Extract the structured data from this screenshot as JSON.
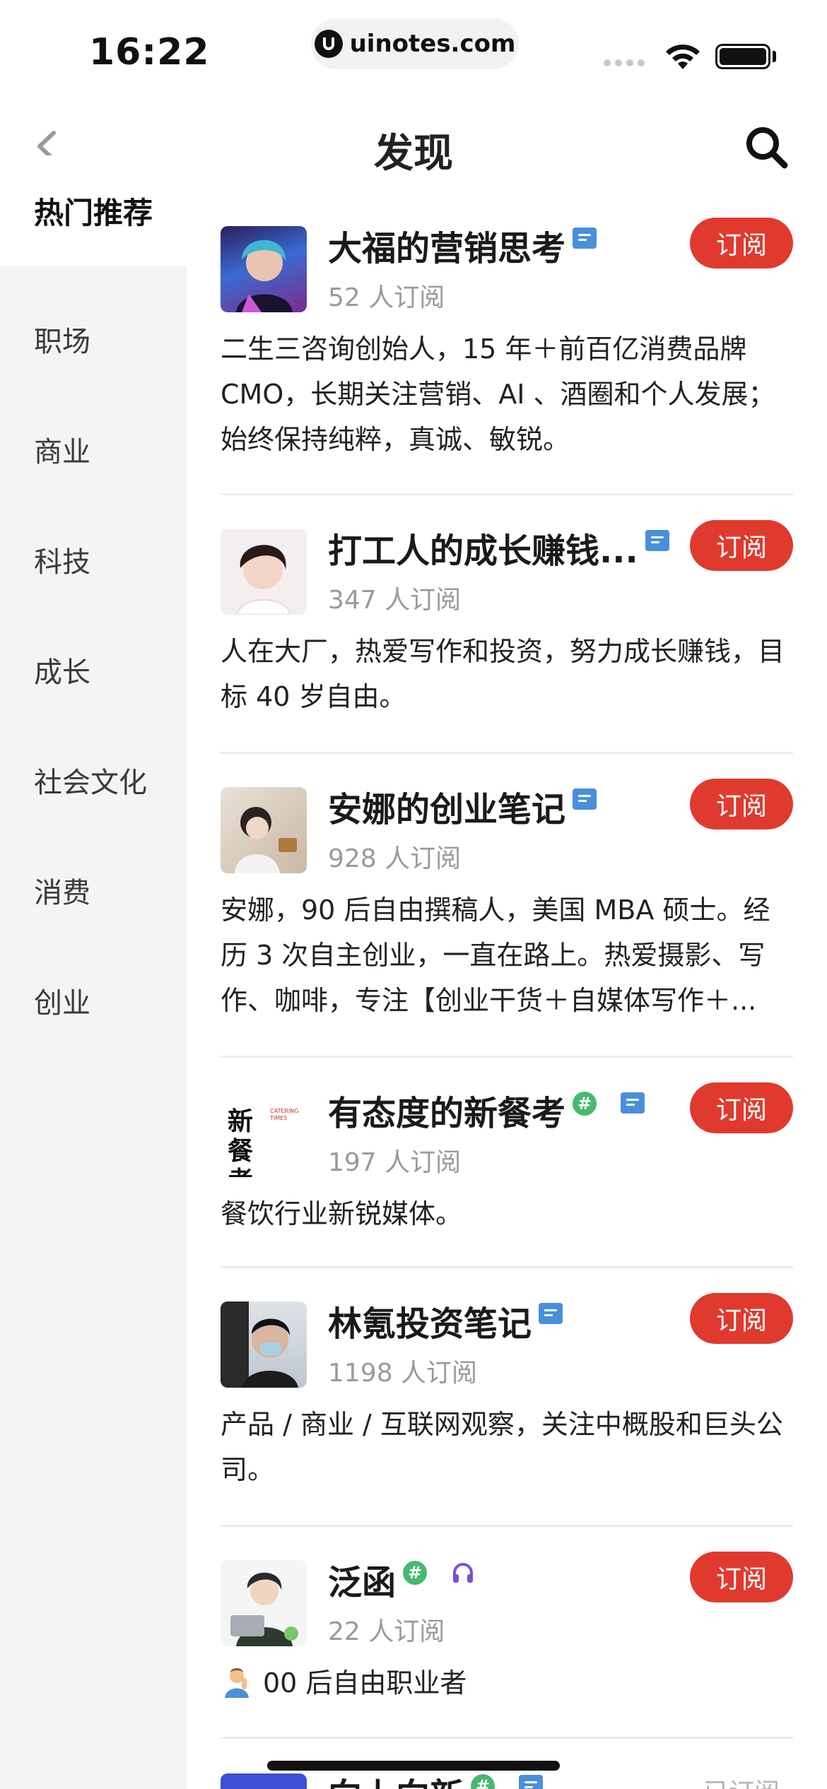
{
  "status": {
    "time": "16:22",
    "url": "uinotes.com"
  },
  "nav": {
    "title": "发现"
  },
  "sidebar": {
    "items": [
      {
        "label": "热门推荐",
        "active": true
      },
      {
        "label": "职场"
      },
      {
        "label": "商业"
      },
      {
        "label": "科技"
      },
      {
        "label": "成长"
      },
      {
        "label": "社会文化"
      },
      {
        "label": "消费"
      },
      {
        "label": "创业"
      }
    ]
  },
  "list": {
    "items": [
      {
        "title": "大福的营销思考",
        "subs": "52 人订阅",
        "button": "订阅",
        "desc": "二生三咨询创始人，15 年＋前百亿消费品牌 CMO，长期关注营销、AI 、酒圈和个人发展；始终保持纯粹，真诚、敏锐。"
      },
      {
        "title": "打工人的成长赚钱...",
        "subs": "347 人订阅",
        "button": "订阅",
        "desc": "人在大厂，热爱写作和投资，努力成长赚钱，目标 40 岁自由。"
      },
      {
        "title": "安娜的创业笔记",
        "subs": "928 人订阅",
        "button": "订阅",
        "desc": "安娜，90 后自由撰稿人，美国 MBA 硕士。经历 3 次自主创业，一直在路上。热爱摄影、写作、咖啡，专注【创业干货＋自媒体写作＋..."
      },
      {
        "title": "有态度的新餐考",
        "subs": "197 人订阅",
        "button": "订阅",
        "desc": "餐饮行业新锐媒体。",
        "logo_text": "新餐考",
        "logo_small": "CATERING TIMES"
      },
      {
        "title": "林氪投资笔记",
        "subs": "1198 人订阅",
        "button": "订阅",
        "desc": "产品 / 商业 / 互联网观察，关注中概股和巨头公司。"
      },
      {
        "title": "泛函",
        "subs": "22 人订阅",
        "button": "订阅",
        "desc": "00 后自由职业者"
      },
      {
        "title": "向上向新",
        "button": "已订阅"
      }
    ]
  },
  "colors": {
    "accent": "#e03a2f",
    "doc_badge": "#4a90d9",
    "hash_badge": "#46b96c",
    "audio_badge": "#7b4fd6"
  }
}
